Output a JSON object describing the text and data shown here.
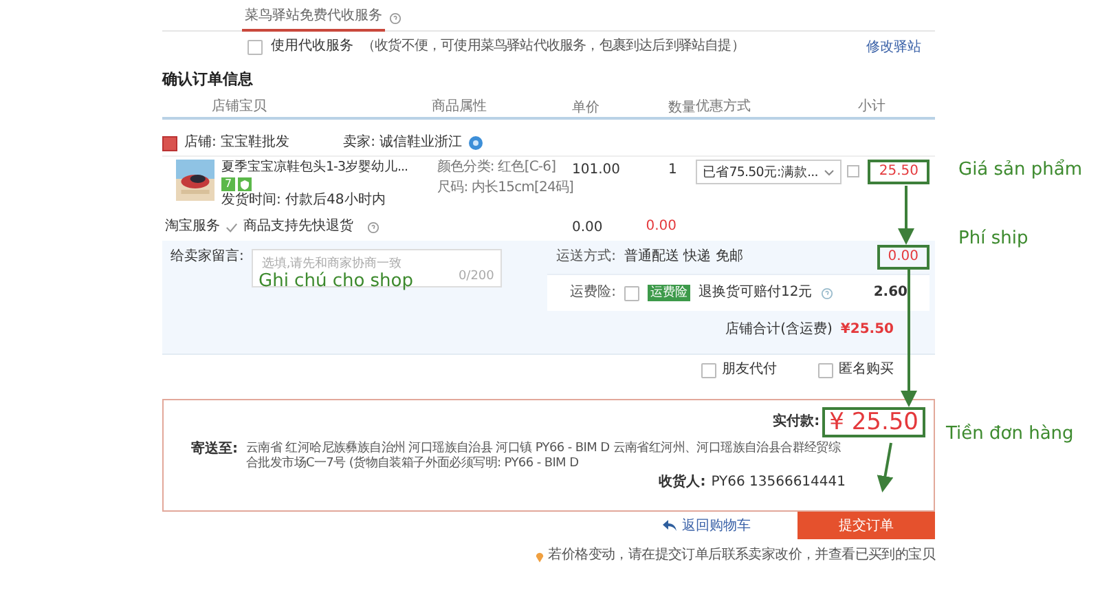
{
  "pickup_service": {
    "tab": "菜鸟驿站免费代收服务",
    "use_service": {
      "label": "使用代收服务",
      "hint": "（收货不便，可使用菜鸟驿站代收服务，包裹到达后到驿站自提）",
      "checked": false
    },
    "change_link": "修改驿站"
  },
  "order": {
    "title": "确认订单信息",
    "columns": [
      "店铺宝贝",
      "商品属性",
      "单价",
      "数量",
      "优惠方式",
      "小计"
    ],
    "shop": {
      "shop": "店铺: 宝宝鞋批发",
      "seller": "卖家: 诚信鞋业浙江"
    },
    "item": {
      "name": "夏季宝宝凉鞋包头1-3岁婴幼儿...",
      "tag": "7",
      "ship_time": "发货时间: 付款后48小时内",
      "attributes": [
        "颜色分类: 红色[C-6]",
        "尺码: 内长15cm[24码]"
      ],
      "price": "101.00",
      "quantity": "1",
      "discount": "已省75.50元:满款...",
      "subtotal": {
        "text": "25.50",
        "highlighted": true
      }
    },
    "service": {
      "label": "淘宝服务",
      "option": "商品支持先快退货",
      "checked": true,
      "price": "0.00",
      "subtotal": "0.00"
    },
    "message": {
      "label": "给卖家留言:",
      "placeholder": "选填,请先和商家协商一致",
      "counter": "0/200"
    },
    "shipping": {
      "label": "运送方式:",
      "method": "普通配送 快递 免邮",
      "fee": {
        "text": "0.00",
        "highlighted": true
      }
    },
    "insurance": {
      "label": "运费险:",
      "checked": false,
      "badge": "运费险",
      "text": "退换货可赔付12元",
      "fee": "2.60"
    },
    "shop_total": {
      "label": "店铺合计(含运费)",
      "amount": "¥25.50"
    },
    "options": [
      {
        "label": "朋友代付",
        "checked": false
      },
      {
        "label": "匿名购买",
        "checked": false
      }
    ]
  },
  "summary": {
    "paid_label": "实付款:",
    "paid": {
      "text": "¥ 25.50",
      "highlighted": true
    },
    "address_label": "寄送至:",
    "address": "云南省 红河哈尼族彝族自治州 河口瑶族自治县 河口镇 PY66 - BIM D 云南省红河州、河口瑶族自治县合群经贸综合批发市场C一7号 (货物自装箱子外面必须写明: PY66 - BIM D",
    "receiver_label": "收货人:",
    "receiver": "PY66 13566614441"
  },
  "actions": {
    "back": "返回购物车",
    "submit": "提交订单"
  },
  "note": "若价格变动，请在提交订单后联系卖家改价，并查看已买到的宝贝",
  "annotations": [
    {
      "text": "Giá sản phẩm"
    },
    {
      "text": "Phí ship"
    },
    {
      "text": "Tiền đơn hàng"
    }
  ],
  "message_annotation": "Ghi chú cho shop"
}
